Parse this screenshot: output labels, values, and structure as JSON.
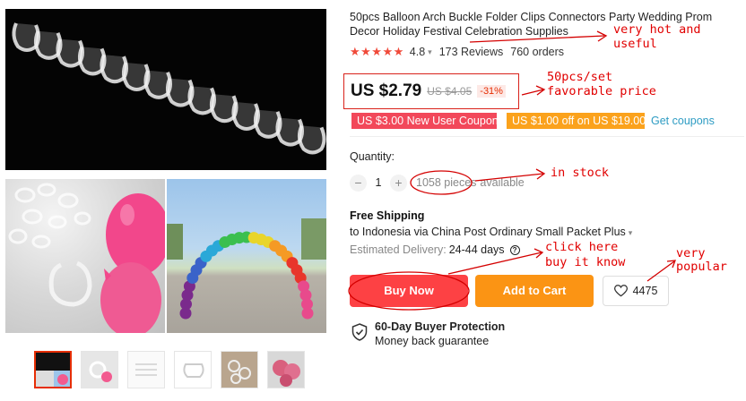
{
  "product": {
    "title": "50pcs Balloon Arch Buckle Folder Clips Connectors Party Wedding Prom Decor Holiday Festival Celebration Supplies",
    "rating": "4.8",
    "reviews": "173 Reviews",
    "orders": "760 orders",
    "stars": "★★★★★"
  },
  "price": {
    "current": "US $2.79",
    "original": "US $4.05",
    "discount": "-31%"
  },
  "coupons": {
    "new_user": "US $3.00 New User Coupon",
    "threshold": "US $1.00 off on US $19.00",
    "get_link": "Get coupons"
  },
  "quantity": {
    "label": "Quantity:",
    "value": "1",
    "minus": "−",
    "plus": "+",
    "available_count": "1058 pieces",
    "available_suffix": "available"
  },
  "shipping": {
    "title": "Free Shipping",
    "route": "to Indonesia via China Post Ordinary Small Packet Plus",
    "delivery_label": "Estimated Delivery:",
    "delivery_value": "24-44 days",
    "help": "?"
  },
  "actions": {
    "buy_now": "Buy Now",
    "add_to_cart": "Add to Cart",
    "wishlist_count": "4475"
  },
  "protection": {
    "title": "60-Day Buyer Protection",
    "subtitle": "Money back guarantee"
  },
  "annotations": {
    "hot_1": "very hot and",
    "hot_2": "useful",
    "price_1": "50pcs/set",
    "price_2": "favorable price",
    "stock": "in stock",
    "click_1": "click here",
    "click_2": "buy it know",
    "popular_1": "very",
    "popular_2": "popular"
  },
  "colors": {
    "accent_red": "#fd4144",
    "accent_orange": "#fb9414",
    "annotation_red": "#e10000",
    "link_blue": "#2e9cc3"
  },
  "icons": {
    "quantity": [
      "minus-icon",
      "plus-icon"
    ],
    "wishlist": "heart-icon",
    "protection": "shield-check-icon",
    "delivery_help": "question-circle-icon"
  }
}
